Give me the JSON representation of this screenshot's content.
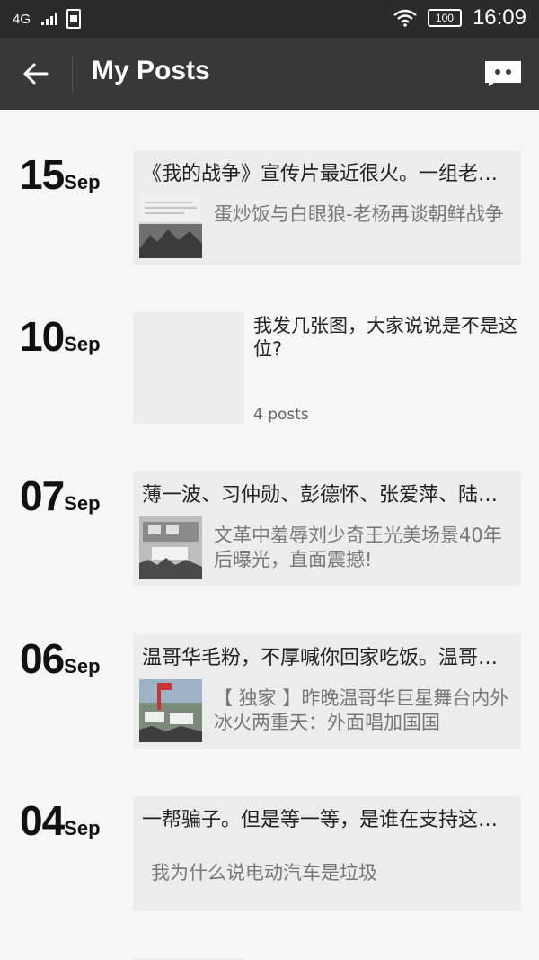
{
  "status_bar": {
    "network": "4G",
    "battery": "100",
    "time": "16:09"
  },
  "app_bar": {
    "title": "My Posts",
    "back_icon": "arrow-left-icon",
    "message_icon": "message-bubble-icon"
  },
  "posts": [
    {
      "day": "15",
      "month": "Sep",
      "title": "《我的战争》宣传片最近很火。一组老照片，带你...",
      "link_text": "蛋炒饭与白眼狼-老杨再谈朝鲜战争"
    },
    {
      "day": "10",
      "month": "Sep",
      "title": "我发几张图，大家说说是不是这位?",
      "count": "4 posts"
    },
    {
      "day": "07",
      "month": "Sep",
      "title": "薄一波、习仲勋、彭德怀、张爱萍、陆定一...",
      "link_text": "文革中羞辱刘少奇王光美场景40年后曝光，直面震撼!"
    },
    {
      "day": "06",
      "month": "Sep",
      "title": "温哥华毛粉，不厚喊你回家吃饭。温哥华...",
      "link_text": "【 独家 】昨晚温哥华巨星舞台内外冰火两重天：外面唱加国国"
    },
    {
      "day": "04",
      "month": "Sep",
      "title": "一帮骗子。但是等一等，是谁在支持这帮骗子...",
      "link_text": "我为什么说电动汽车是垃圾"
    }
  ]
}
